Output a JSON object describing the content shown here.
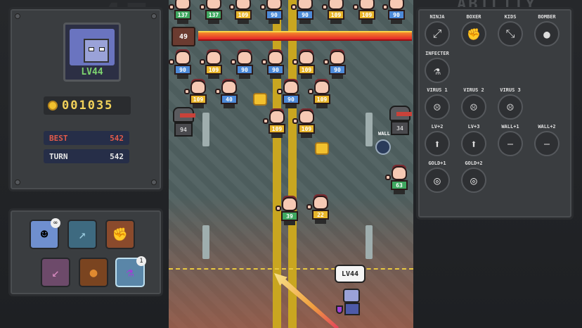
{
  "player": {
    "level": "LV44",
    "coins": "001035"
  },
  "stats": {
    "best_label": "BEST",
    "best_value": "542",
    "turn_label": "TURN",
    "turn_value": "542"
  },
  "items": [
    {
      "name": "ghost",
      "icon": "ghost-icon",
      "badge": "∞"
    },
    {
      "name": "arrow-up-right",
      "icon": "arrow-icon",
      "badge": ""
    },
    {
      "name": "fist",
      "icon": "fist-icon",
      "badge": ""
    },
    {
      "name": "arrow-down-left",
      "icon": "arrow-icon",
      "badge": ""
    },
    {
      "name": "orb",
      "icon": "orb-icon",
      "badge": ""
    },
    {
      "name": "potion",
      "icon": "potion-icon",
      "badge": "1"
    }
  ],
  "boss": {
    "hp": "49"
  },
  "enemies": {
    "row1": [
      "137",
      "137",
      "109",
      "90",
      "90",
      "109",
      "109",
      "90"
    ],
    "row2": [
      "90",
      "109",
      "90",
      "90",
      "109",
      "90"
    ],
    "row3": [
      "109",
      "40",
      "90",
      "109"
    ],
    "row4": [
      "109",
      "109"
    ],
    "robots": [
      "94",
      "34"
    ],
    "lower": [
      "63",
      "39",
      "22"
    ]
  },
  "bubble": "LV44",
  "wall_label": "WALL",
  "abilities": {
    "title": "ABILITY",
    "list": [
      {
        "label": "NINJA",
        "icon": "ninja-icon"
      },
      {
        "label": "BOXER",
        "icon": "boxer-icon"
      },
      {
        "label": "KIDS",
        "icon": "kids-icon"
      },
      {
        "label": "BOMBER",
        "icon": "bomber-icon"
      },
      {
        "label": "INFECTER",
        "icon": "infecter-icon"
      },
      {
        "label": "VIRUS 1",
        "icon": "virus-icon"
      },
      {
        "label": "VIRUS 2",
        "icon": "virus-icon"
      },
      {
        "label": "VIRUS 3",
        "icon": "virus-icon"
      },
      {
        "label": "LV+2",
        "icon": "levelup-icon"
      },
      {
        "label": "LV+3",
        "icon": "levelup-icon"
      },
      {
        "label": "WALL+1",
        "icon": "wall-icon"
      },
      {
        "label": "WALL+2",
        "icon": "wall-icon"
      },
      {
        "label": "GOLD+1",
        "icon": "gold-icon"
      },
      {
        "label": "GOLD+2",
        "icon": "gold-icon"
      }
    ]
  },
  "colors": {
    "coin": "#f2c12e",
    "best": "#e25a4a",
    "level": "#7dd36f"
  }
}
